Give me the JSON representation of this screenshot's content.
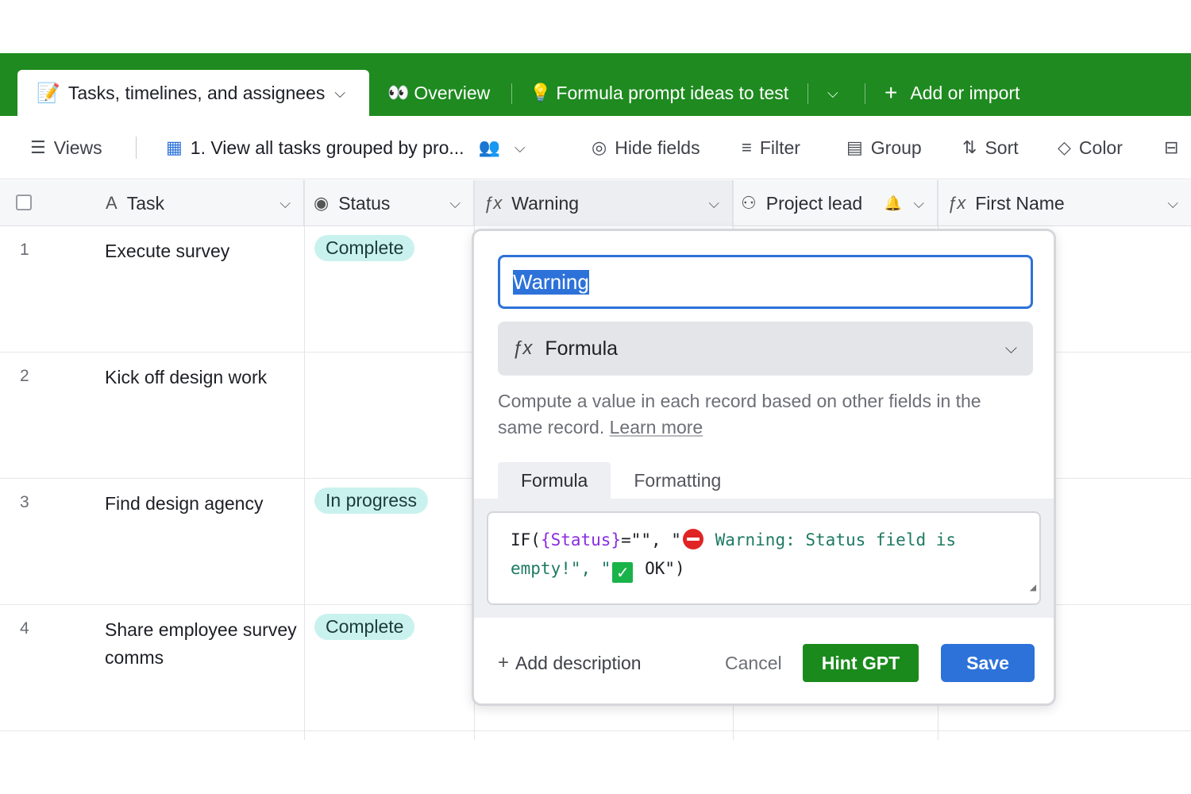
{
  "tabs": {
    "active": {
      "icon": "memo-icon",
      "label": "Tasks, timelines, and assignees"
    },
    "overview": {
      "icon": "eyes-icon",
      "label": "Overview"
    },
    "formula_ideas": {
      "icon": "bulb-icon",
      "label": "Formula prompt ideas to test"
    },
    "add_import": {
      "label": "Add or import"
    }
  },
  "toolbar": {
    "views": "Views",
    "view_name": "1. View all tasks grouped by pro...",
    "hide_fields": "Hide fields",
    "filter": "Filter",
    "group": "Group",
    "sort": "Sort",
    "color": "Color"
  },
  "columns": [
    {
      "label": "Task",
      "icon": "text-icon"
    },
    {
      "label": "Status",
      "icon": "status-icon"
    },
    {
      "label": "Warning",
      "icon": "formula-icon"
    },
    {
      "label": "Project lead",
      "icon": "user-icon"
    },
    {
      "label": "First Name",
      "icon": "formula-icon"
    }
  ],
  "rows": [
    {
      "num": "1",
      "task": "Execute survey",
      "status": "Complete"
    },
    {
      "num": "2",
      "task": "Kick off design work",
      "status": ""
    },
    {
      "num": "3",
      "task": "Find design agency",
      "status": "In progress"
    },
    {
      "num": "4",
      "task": "Share employee survey comms",
      "status": "Complete"
    }
  ],
  "dialog": {
    "field_name": "Warning",
    "field_type": "Formula",
    "description": "Compute a value in each record based on other fields in the same record.",
    "learn_more": "Learn more",
    "subtabs": [
      "Formula",
      "Formatting"
    ],
    "formula": {
      "fn": "IF(",
      "field": "{Status}",
      "part1": "=\"\", \"",
      "warning_text": " Warning: Status field is empty!\", \"",
      "ok_text": " OK\")"
    },
    "add_description": "Add description",
    "cancel": "Cancel",
    "hint_gpt": "Hint GPT",
    "save": "Save"
  },
  "colors": {
    "brand_green": "#1e8a1f",
    "accent_blue": "#2d72d9",
    "status_pill": "#c9f2ee"
  }
}
